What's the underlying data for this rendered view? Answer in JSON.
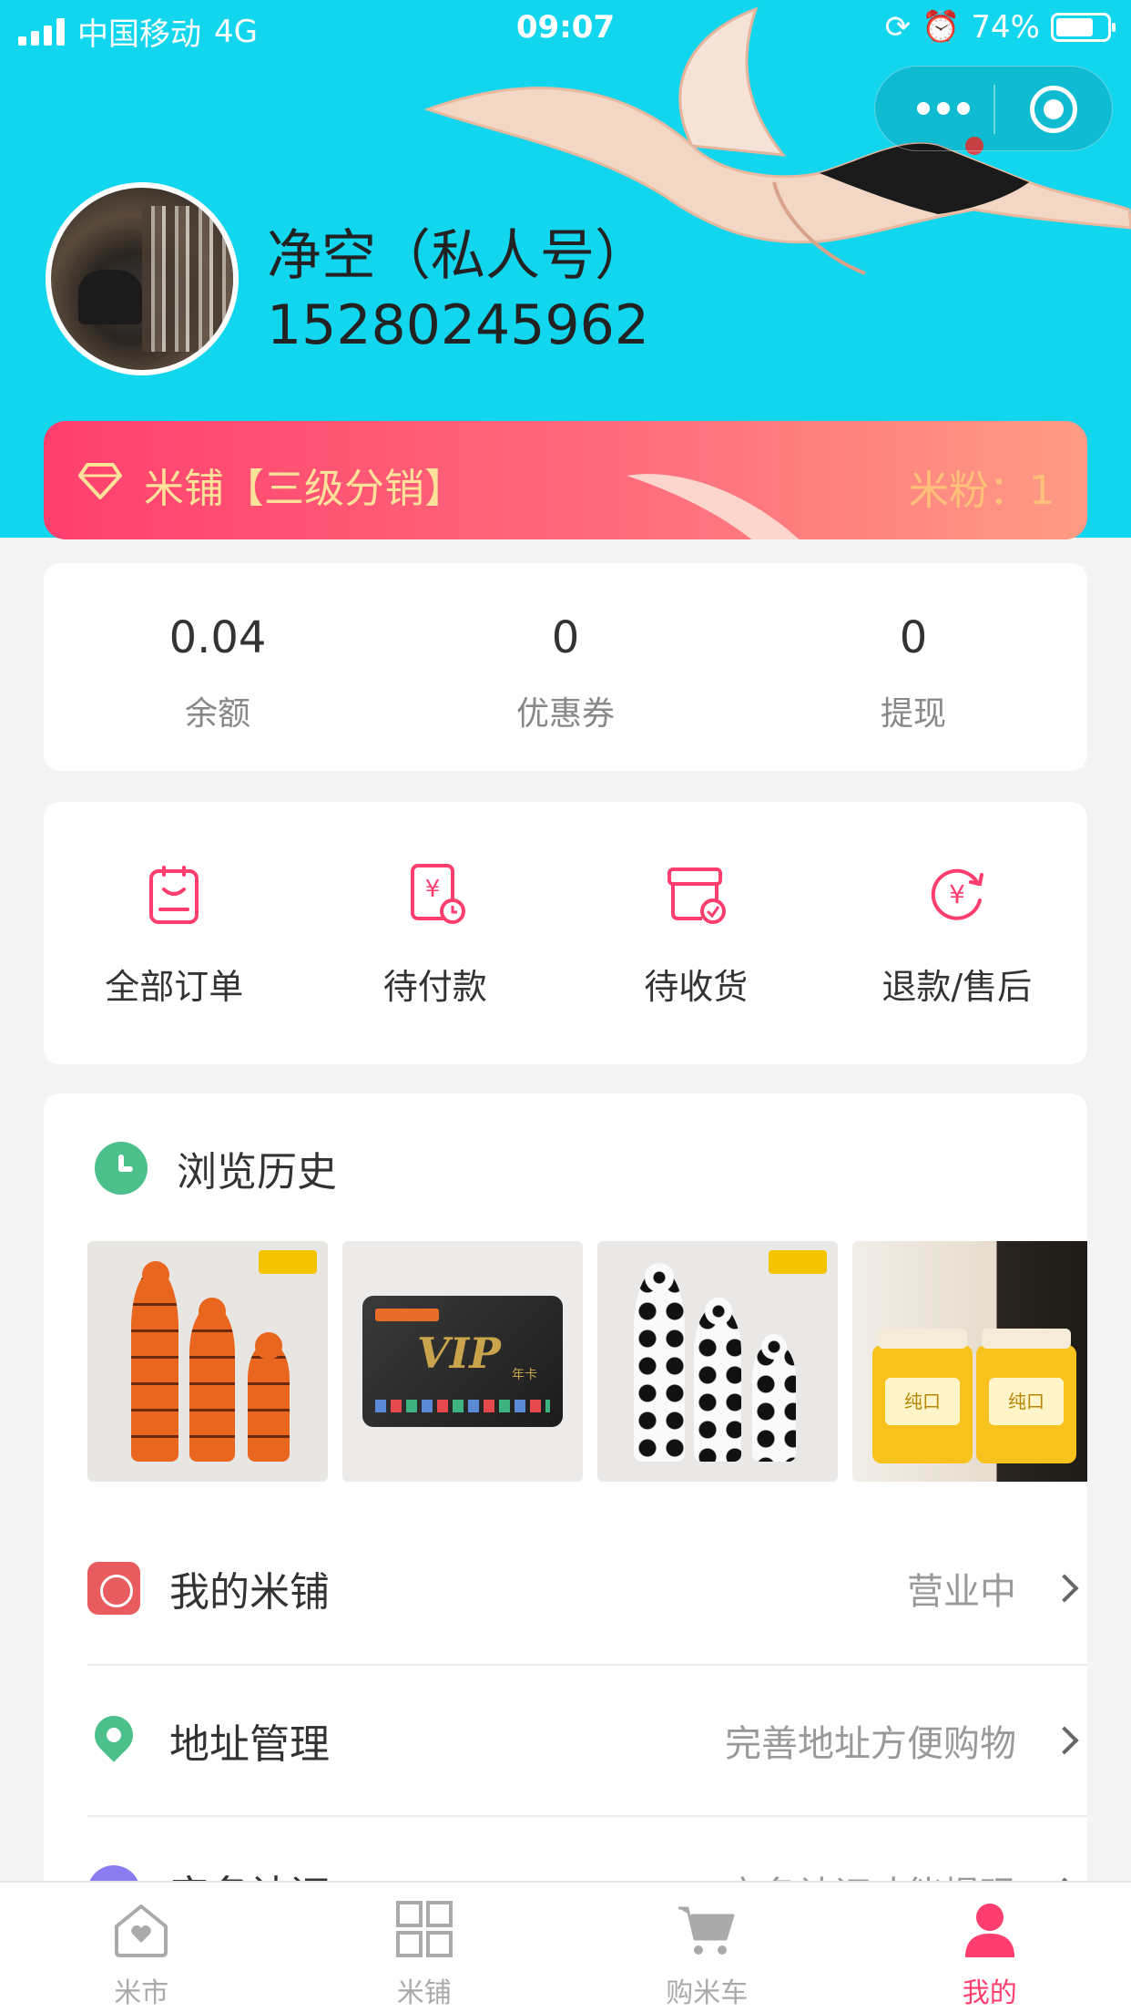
{
  "status_bar": {
    "carrier": "中国移动",
    "network": "4G",
    "time": "09:07",
    "battery": "74%",
    "battery_level": 0.74
  },
  "profile": {
    "name": "净空（私人号）",
    "phone": "15280245962"
  },
  "level": {
    "title": "米铺【三级分销】",
    "fans": "米粉：1"
  },
  "stats": [
    {
      "value": "0.04",
      "label": "余额"
    },
    {
      "value": "0",
      "label": "优惠券"
    },
    {
      "value": "0",
      "label": "提现"
    }
  ],
  "orders": [
    {
      "label": "全部订单",
      "icon": "clipboard-icon"
    },
    {
      "label": "待付款",
      "icon": "bill-clock-icon"
    },
    {
      "label": "待收货",
      "icon": "package-check-icon"
    },
    {
      "label": "退款/售后",
      "icon": "yen-refresh-icon"
    }
  ],
  "history": {
    "title": "浏览历史",
    "products": [
      {
        "name": "basketball-bottles"
      },
      {
        "name": "vip-card",
        "badge": "VIP",
        "card_label": "年卡"
      },
      {
        "name": "soccer-bottles"
      },
      {
        "name": "honey-jars",
        "jar_label": "纯口"
      }
    ]
  },
  "menu": [
    {
      "label": "我的米铺",
      "status": "营业中",
      "icon": "shop-icon"
    },
    {
      "label": "地址管理",
      "status": "完善地址方便购物",
      "icon": "location-pin-icon"
    },
    {
      "label": "实名认证",
      "status": "实名认证才能提现",
      "icon": "verify-icon"
    }
  ],
  "tabs": [
    {
      "label": "米市",
      "icon": "home-heart-icon",
      "active": false
    },
    {
      "label": "米铺",
      "icon": "grid-icon",
      "active": false
    },
    {
      "label": "购米车",
      "icon": "cart-icon",
      "active": false
    },
    {
      "label": "我的",
      "icon": "person-icon",
      "active": true
    }
  ],
  "colors": {
    "header": "#12d5ee",
    "accent": "#ff3d6e",
    "green": "#4cc08a"
  }
}
